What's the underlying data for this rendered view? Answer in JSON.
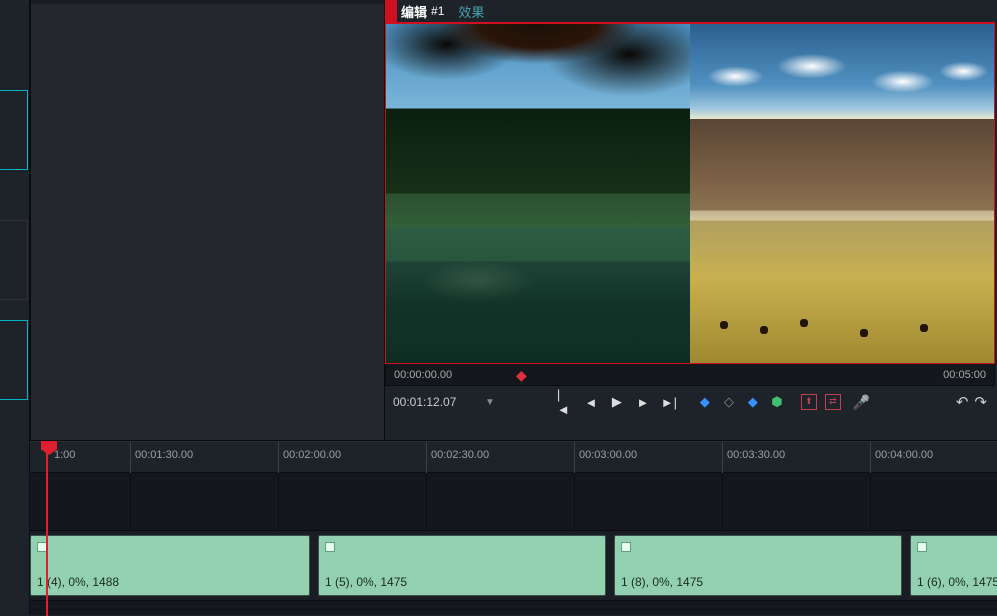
{
  "preview": {
    "tabs": {
      "edit_label": "编辑",
      "edit_suffix": "#1",
      "effects_label": "效果"
    },
    "mini_timeline": {
      "start_tc": "00:00:00.00",
      "end_tc": "00:05:00",
      "current_tc": "00:01:12.07"
    },
    "transport": {
      "first": "|◄",
      "prev": "◄",
      "play": "▶",
      "next": "►",
      "last": "►|",
      "mark_in": "◆",
      "mark_clear": "◇",
      "mark_in2": "◆",
      "mark_ab": "⬢",
      "tool_insert": "↧",
      "tool_overwrite": "⇥",
      "mic": "🎤",
      "undo": "↶",
      "redo": "↷"
    }
  },
  "timeline": {
    "ruler_start_label": "1:00",
    "ticks": [
      {
        "label": "00:01:30.00"
      },
      {
        "label": "00:02:00.00"
      },
      {
        "label": "00:02:30.00"
      },
      {
        "label": "00:03:00.00"
      },
      {
        "label": "00:03:30.00"
      },
      {
        "label": "00:04:00.00"
      }
    ],
    "clips": [
      {
        "label": "1 (4), 0%, 1488"
      },
      {
        "label": "1 (5), 0%, 1475"
      },
      {
        "label": "1 (8), 0%, 1475"
      },
      {
        "label": "1 (6), 0%, 1475"
      }
    ]
  }
}
